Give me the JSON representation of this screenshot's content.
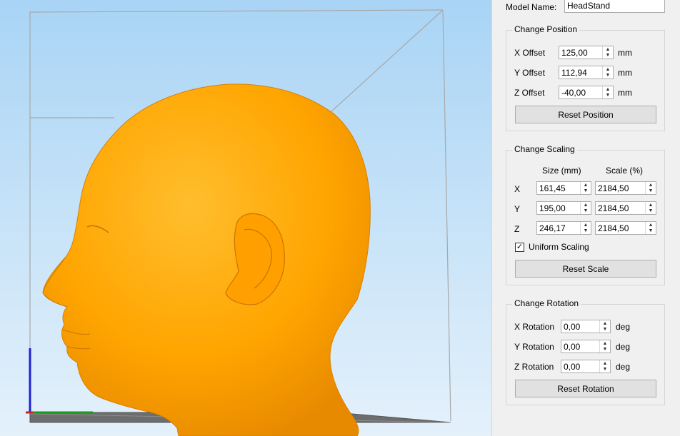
{
  "model": {
    "name_label": "Model Name:",
    "name_value": "HeadStand"
  },
  "position": {
    "title": "Change Position",
    "x_label": "X Offset",
    "x_value": "125,00",
    "y_label": "Y Offset",
    "y_value": "112,94",
    "z_label": "Z Offset",
    "z_value": "-40,00",
    "unit": "mm",
    "reset_label": "Reset Position"
  },
  "scaling": {
    "title": "Change Scaling",
    "size_header": "Size (mm)",
    "scale_header": "Scale (%)",
    "rows": [
      {
        "axis": "X",
        "size": "161,45",
        "scale": "2184,50"
      },
      {
        "axis": "Y",
        "size": "195,00",
        "scale": "2184,50"
      },
      {
        "axis": "Z",
        "size": "246,17",
        "scale": "2184,50"
      }
    ],
    "uniform_label": "Uniform Scaling",
    "uniform_checked": true,
    "reset_label": "Reset Scale"
  },
  "rotation": {
    "title": "Change Rotation",
    "x_label": "X Rotation",
    "x_value": "0,00",
    "y_label": "Y Rotation",
    "y_value": "0,00",
    "z_label": "Z Rotation",
    "z_value": "0,00",
    "unit": "deg",
    "reset_label": "Reset Rotation"
  },
  "colors": {
    "viewport_top": "#a9d4f5",
    "viewport_bottom": "#e4f1fb",
    "model": "#ffa500",
    "model_shade": "#e88a00",
    "model_highlight": "#ffbe2e",
    "panel_bg": "#f0f0f0"
  }
}
